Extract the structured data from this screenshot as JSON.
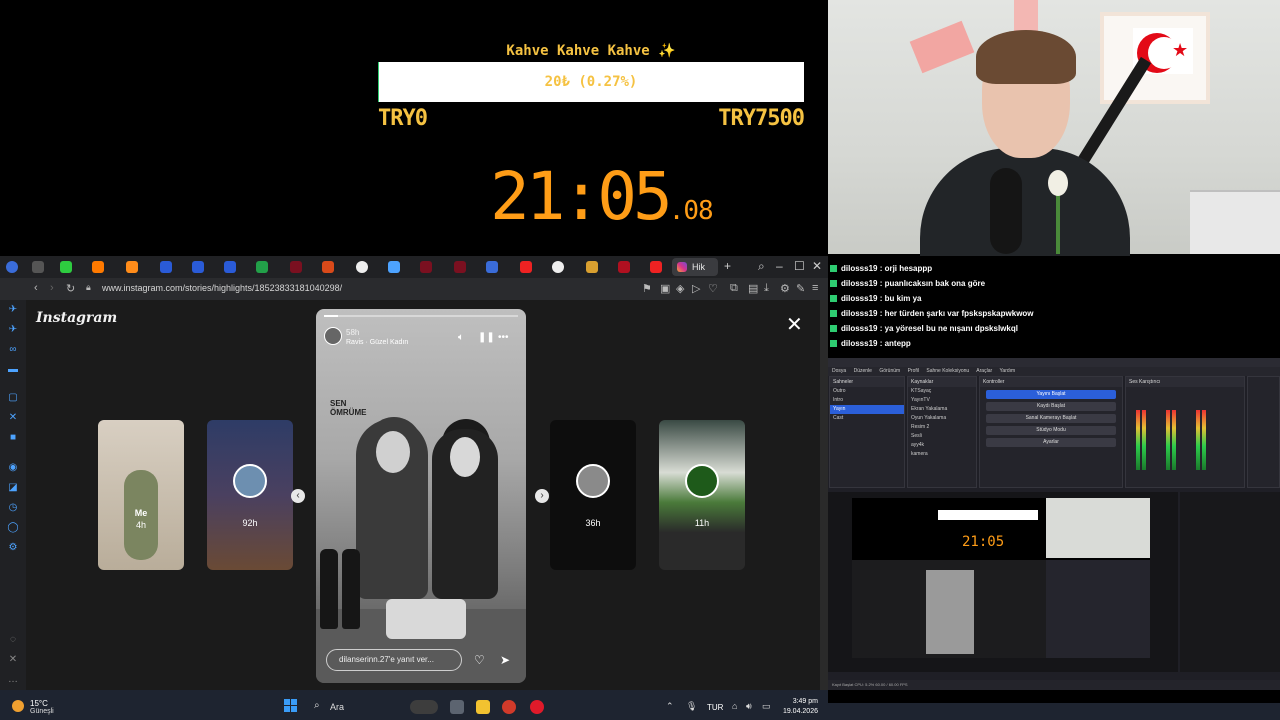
{
  "overlay": {
    "goal_title": "Kahve Kahve Kahve ✨",
    "goal_text": "20₺ (0.27%)",
    "goal_progress": 0.27,
    "goal_min": "TRY0",
    "goal_max": "TRY7500",
    "clock": "21:05",
    "clock_ms": ".08"
  },
  "browser": {
    "active_tab": "Hik",
    "url": "www.instagram.com/stories/highlights/18523833181040298/"
  },
  "instagram": {
    "logo": "Instagram",
    "side_stories": [
      {
        "label": "Me",
        "age": "4h"
      },
      {
        "label": "",
        "age": "92h"
      },
      {
        "label": "",
        "age": "36h"
      },
      {
        "label": "",
        "age": "11h"
      }
    ],
    "story_user": "58h",
    "story_song": "Ravis · Güzel Kadın",
    "story_text": "SEN ÖMRÜME",
    "reply_placeholder": "dilanserinn.27'e yanıt ver..."
  },
  "chat": {
    "messages": [
      {
        "user": "dilosss19",
        "text": "orji hesappp"
      },
      {
        "user": "dilosss19",
        "text": "puanlıcaksın bak ona göre"
      },
      {
        "user": "dilosss19",
        "text": "bu kim ya"
      },
      {
        "user": "dilosss19",
        "text": "her türden şarkı var fpskspskapwkwow"
      },
      {
        "user": "dilosss19",
        "text": "ya yöresel bu ne nışanı dpsksIwkql"
      },
      {
        "user": "dilosss19",
        "text": "antepp"
      }
    ]
  },
  "obs": {
    "menu": [
      "Dosya",
      "Düzenle",
      "Görünüm",
      "Profil",
      "Sahne Koleksiyonu",
      "Araçlar",
      "Yardım"
    ],
    "docks": {
      "scenes": {
        "title": "Sahneler",
        "items": [
          "Outro",
          "Intro",
          "Yayın",
          "Cast"
        ],
        "selected": 2
      },
      "sources": {
        "title": "Kaynaklar",
        "items": [
          "KTSayaç",
          "YayınTV",
          "Ekran Yakalama",
          "Oyun Yakalama",
          "Resim 2",
          "Sesli",
          "ayy4k",
          "kamera"
        ]
      },
      "controls": {
        "title": "Kontroller",
        "buttons": [
          "Yayını Başlat",
          "Kaydı Başlat",
          "Sanal Kamerayı Başlat",
          "Stüdyo Modu",
          "Ayarlar"
        ]
      },
      "mixer": {
        "title": "Ses Karıştırıcı"
      }
    },
    "status": "Kayıt Başlat  CPU: 5.2%  60.00 / 60.00 FPS"
  },
  "taskbar": {
    "temp": "15°C",
    "weather": "Güneşli",
    "search": "Ara",
    "lang": "TUR",
    "time": "3:49 pm",
    "date": "19.04.2026"
  },
  "colors": {
    "accent_orange": "#ff9d17",
    "accent_gold": "#f5c242",
    "chat_mark": "#2ecc71",
    "obs_blue": "#2b5fd9"
  }
}
